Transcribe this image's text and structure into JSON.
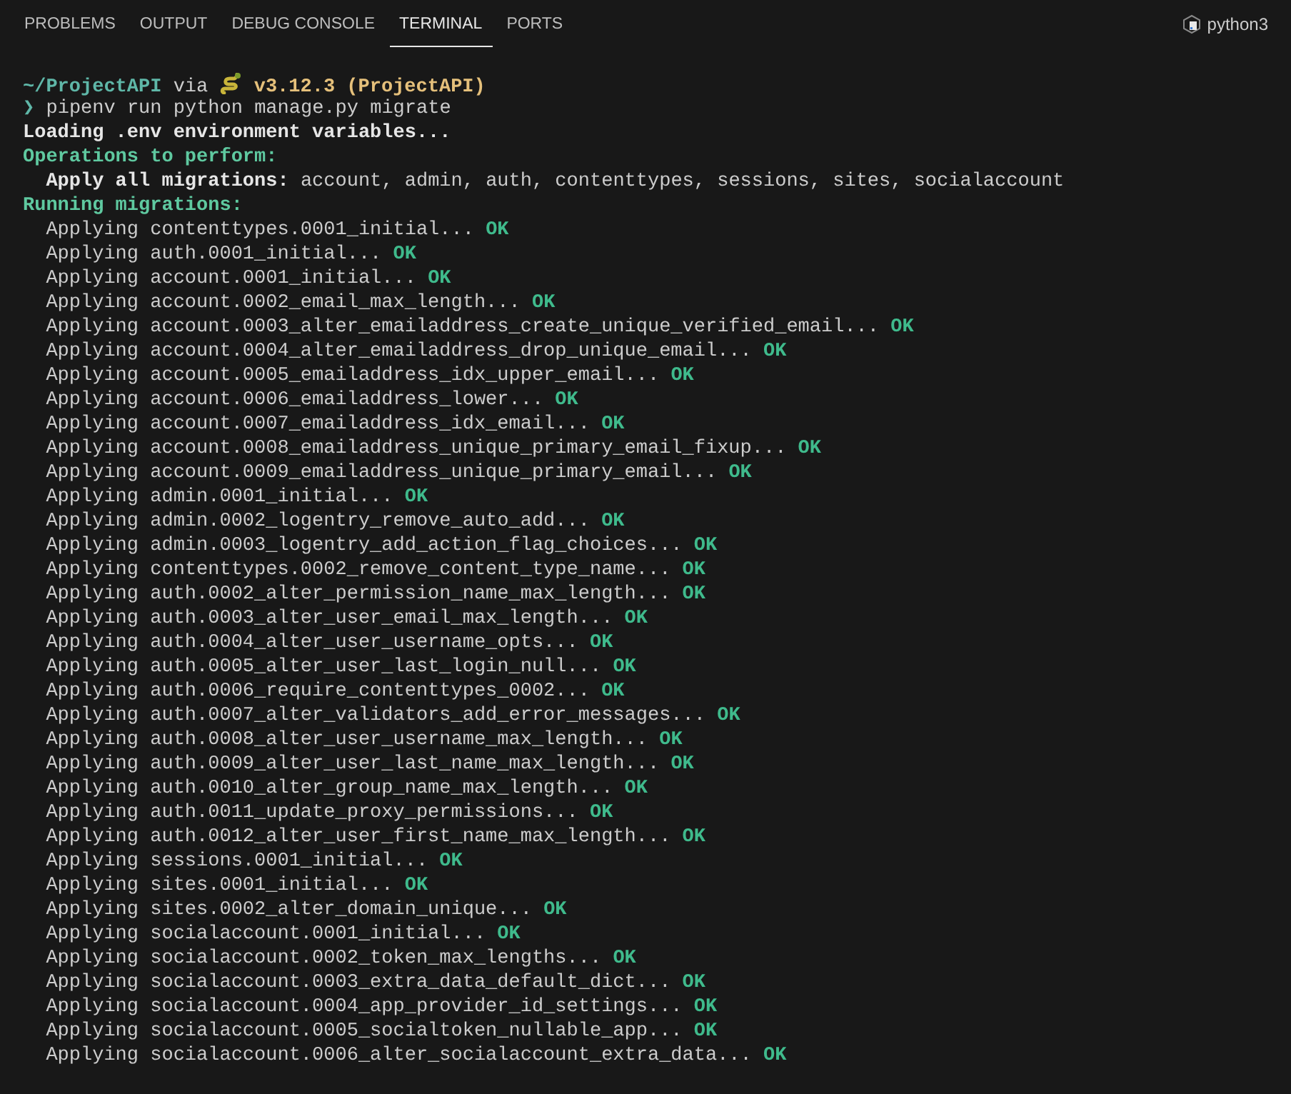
{
  "tabs": [
    {
      "label": "PROBLEMS",
      "selected": false
    },
    {
      "label": "OUTPUT",
      "selected": false
    },
    {
      "label": "DEBUG CONSOLE",
      "selected": false
    },
    {
      "label": "TERMINAL",
      "selected": true
    },
    {
      "label": "PORTS",
      "selected": false
    }
  ],
  "terminal_profile": {
    "label": "python3"
  },
  "prompt": {
    "path": "~/ProjectAPI",
    "via": "via",
    "version": "v3.12.3 (ProjectAPI)",
    "symbol": "❯",
    "command": "pipenv run python manage.py migrate"
  },
  "output": [
    {
      "kind": "bold",
      "text": "Loading .env environment variables..."
    },
    {
      "kind": "heading",
      "text": "Operations to perform:"
    },
    {
      "kind": "labelled",
      "label": "Apply all migrations:",
      "text": "account, admin, auth, contenttypes, sessions, sites, socialaccount"
    },
    {
      "kind": "heading",
      "text": "Running migrations:"
    }
  ],
  "migrations": [
    {
      "text": "Applying contenttypes.0001_initial...",
      "status": "OK"
    },
    {
      "text": "Applying auth.0001_initial...",
      "status": "OK"
    },
    {
      "text": "Applying account.0001_initial...",
      "status": "OK"
    },
    {
      "text": "Applying account.0002_email_max_length...",
      "status": "OK"
    },
    {
      "text": "Applying account.0003_alter_emailaddress_create_unique_verified_email...",
      "status": "OK"
    },
    {
      "text": "Applying account.0004_alter_emailaddress_drop_unique_email...",
      "status": "OK"
    },
    {
      "text": "Applying account.0005_emailaddress_idx_upper_email...",
      "status": "OK"
    },
    {
      "text": "Applying account.0006_emailaddress_lower...",
      "status": "OK"
    },
    {
      "text": "Applying account.0007_emailaddress_idx_email...",
      "status": "OK"
    },
    {
      "text": "Applying account.0008_emailaddress_unique_primary_email_fixup...",
      "status": "OK"
    },
    {
      "text": "Applying account.0009_emailaddress_unique_primary_email...",
      "status": "OK"
    },
    {
      "text": "Applying admin.0001_initial...",
      "status": "OK"
    },
    {
      "text": "Applying admin.0002_logentry_remove_auto_add...",
      "status": "OK"
    },
    {
      "text": "Applying admin.0003_logentry_add_action_flag_choices...",
      "status": "OK"
    },
    {
      "text": "Applying contenttypes.0002_remove_content_type_name...",
      "status": "OK"
    },
    {
      "text": "Applying auth.0002_alter_permission_name_max_length...",
      "status": "OK"
    },
    {
      "text": "Applying auth.0003_alter_user_email_max_length...",
      "status": "OK"
    },
    {
      "text": "Applying auth.0004_alter_user_username_opts...",
      "status": "OK"
    },
    {
      "text": "Applying auth.0005_alter_user_last_login_null...",
      "status": "OK"
    },
    {
      "text": "Applying auth.0006_require_contenttypes_0002...",
      "status": "OK"
    },
    {
      "text": "Applying auth.0007_alter_validators_add_error_messages...",
      "status": "OK"
    },
    {
      "text": "Applying auth.0008_alter_user_username_max_length...",
      "status": "OK"
    },
    {
      "text": "Applying auth.0009_alter_user_last_name_max_length...",
      "status": "OK"
    },
    {
      "text": "Applying auth.0010_alter_group_name_max_length...",
      "status": "OK"
    },
    {
      "text": "Applying auth.0011_update_proxy_permissions...",
      "status": "OK"
    },
    {
      "text": "Applying auth.0012_alter_user_first_name_max_length...",
      "status": "OK"
    },
    {
      "text": "Applying sessions.0001_initial...",
      "status": "OK"
    },
    {
      "text": "Applying sites.0001_initial...",
      "status": "OK"
    },
    {
      "text": "Applying sites.0002_alter_domain_unique...",
      "status": "OK"
    },
    {
      "text": "Applying socialaccount.0001_initial...",
      "status": "OK"
    },
    {
      "text": "Applying socialaccount.0002_token_max_lengths...",
      "status": "OK"
    },
    {
      "text": "Applying socialaccount.0003_extra_data_default_dict...",
      "status": "OK"
    },
    {
      "text": "Applying socialaccount.0004_app_provider_id_settings...",
      "status": "OK"
    },
    {
      "text": "Applying socialaccount.0005_socialtoken_nullable_app...",
      "status": "OK"
    },
    {
      "text": "Applying socialaccount.0006_alter_socialaccount_extra_data...",
      "status": "OK"
    }
  ]
}
